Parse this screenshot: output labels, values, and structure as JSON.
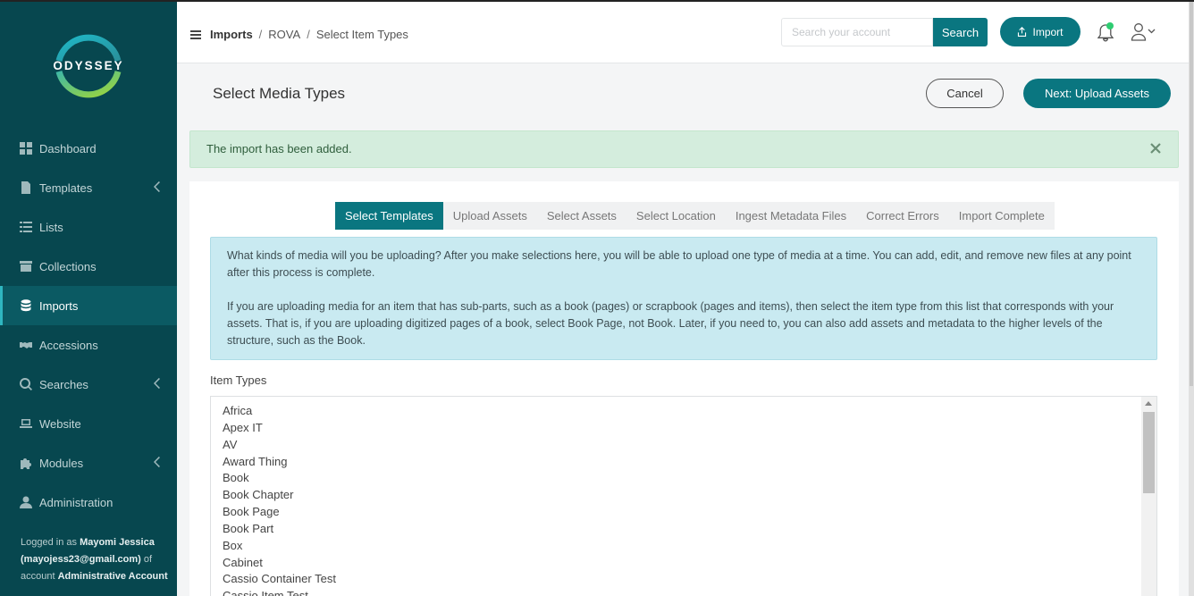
{
  "app": {
    "logo_text": "ODYSSEY"
  },
  "sidebar": {
    "items": [
      {
        "label": "Dashboard",
        "icon": "dashboard-icon",
        "has_submenu": false,
        "active": false
      },
      {
        "label": "Templates",
        "icon": "file-icon",
        "has_submenu": true,
        "active": false
      },
      {
        "label": "Lists",
        "icon": "list-icon",
        "has_submenu": false,
        "active": false
      },
      {
        "label": "Collections",
        "icon": "archive-icon",
        "has_submenu": false,
        "active": false
      },
      {
        "label": "Imports",
        "icon": "database-icon",
        "has_submenu": false,
        "active": true
      },
      {
        "label": "Accessions",
        "icon": "handshake-icon",
        "has_submenu": false,
        "active": false
      },
      {
        "label": "Searches",
        "icon": "search-icon",
        "has_submenu": true,
        "active": false
      },
      {
        "label": "Website",
        "icon": "laptop-icon",
        "has_submenu": false,
        "active": false
      },
      {
        "label": "Modules",
        "icon": "puzzle-icon",
        "has_submenu": true,
        "active": false
      },
      {
        "label": "Administration",
        "icon": "user-icon",
        "has_submenu": false,
        "active": false
      }
    ],
    "login": {
      "prefix": "Logged in as ",
      "name": "Mayomi Jessica",
      "email": "(mayojess23@gmail.com)",
      "of": " of",
      "account_prefix": "account ",
      "account": "Administrative Account"
    }
  },
  "header": {
    "breadcrumb": [
      "Imports",
      "ROVA",
      "Select Item Types"
    ],
    "search_placeholder": "Search your account",
    "search_label": "Search",
    "import_label": "Import"
  },
  "page": {
    "title": "Select Media Types",
    "cancel_label": "Cancel",
    "next_label": "Next: Upload Assets"
  },
  "alert": {
    "text": "The import has been added."
  },
  "tabs": [
    {
      "label": "Select Templates",
      "active": true
    },
    {
      "label": "Upload Assets",
      "active": false
    },
    {
      "label": "Select Assets",
      "active": false
    },
    {
      "label": "Select Location",
      "active": false
    },
    {
      "label": "Ingest Metadata Files",
      "active": false
    },
    {
      "label": "Correct Errors",
      "active": false
    },
    {
      "label": "Import Complete",
      "active": false
    }
  ],
  "info": {
    "p1": "What kinds of media will you be uploading? After you make selections here, you will be able to upload one type of media at a time. You can add, edit, and remove new files at any point after this process is complete.",
    "p2": "If you are uploading media for an item that has sub-parts, such as a book (pages) or scrapbook (pages and items), then select the item type from this list that corresponds with your assets. That is, if you are uploading digitized pages of a book, select Book Page, not Book. Later, if you need to, you can also add assets and metadata to the higher levels of the structure, such as the Book."
  },
  "item_types": {
    "label": "Item Types",
    "options": [
      "Africa",
      "Apex IT",
      "AV",
      "Award Thing",
      "Book",
      "Book Chapter",
      "Book Page",
      "Book Part",
      "Box",
      "Cabinet",
      "Cassio Container Test",
      "Cassio Item Test"
    ]
  },
  "colors": {
    "sidebar_bg": "#07474f",
    "accent": "#0a7680",
    "alert_bg": "#d4eddd",
    "info_bg": "#c9eaf1"
  }
}
